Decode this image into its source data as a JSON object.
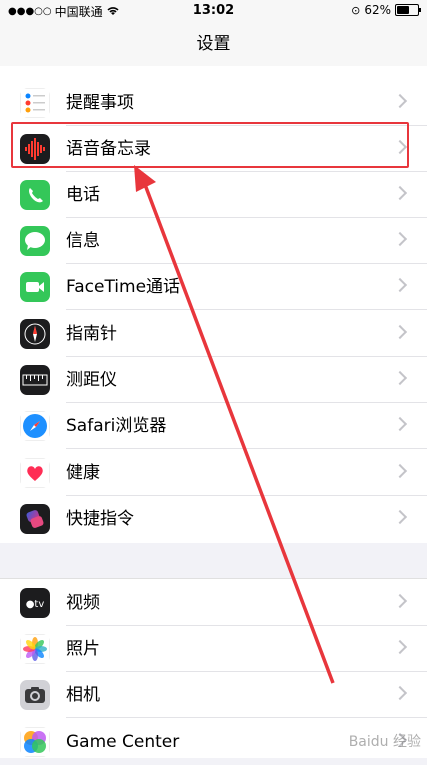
{
  "status_bar": {
    "carrier": "中国联通",
    "time": "13:02",
    "battery": "62%",
    "battery_level": 0.62
  },
  "nav": {
    "title": "设置"
  },
  "group1": [
    {
      "label": "提醒事项",
      "icon": "reminders-icon"
    },
    {
      "label": "语音备忘录",
      "icon": "voice-memos-icon",
      "highlighted": true
    },
    {
      "label": "电话",
      "icon": "phone-icon"
    },
    {
      "label": "信息",
      "icon": "messages-icon"
    },
    {
      "label": "FaceTime通话",
      "icon": "facetime-icon"
    },
    {
      "label": "指南针",
      "icon": "compass-icon"
    },
    {
      "label": "测距仪",
      "icon": "measure-icon"
    },
    {
      "label": "Safari浏览器",
      "icon": "safari-icon"
    },
    {
      "label": "健康",
      "icon": "health-icon"
    },
    {
      "label": "快捷指令",
      "icon": "shortcuts-icon"
    }
  ],
  "group2": [
    {
      "label": "视频",
      "icon": "tv-icon"
    },
    {
      "label": "照片",
      "icon": "photos-icon"
    },
    {
      "label": "相机",
      "icon": "camera-icon"
    },
    {
      "label": "Game Center",
      "icon": "game-center-icon"
    }
  ],
  "watermark": "Baidu 经验",
  "colors": {
    "highlight": "#e8363c",
    "background": "#f2f2f7"
  }
}
